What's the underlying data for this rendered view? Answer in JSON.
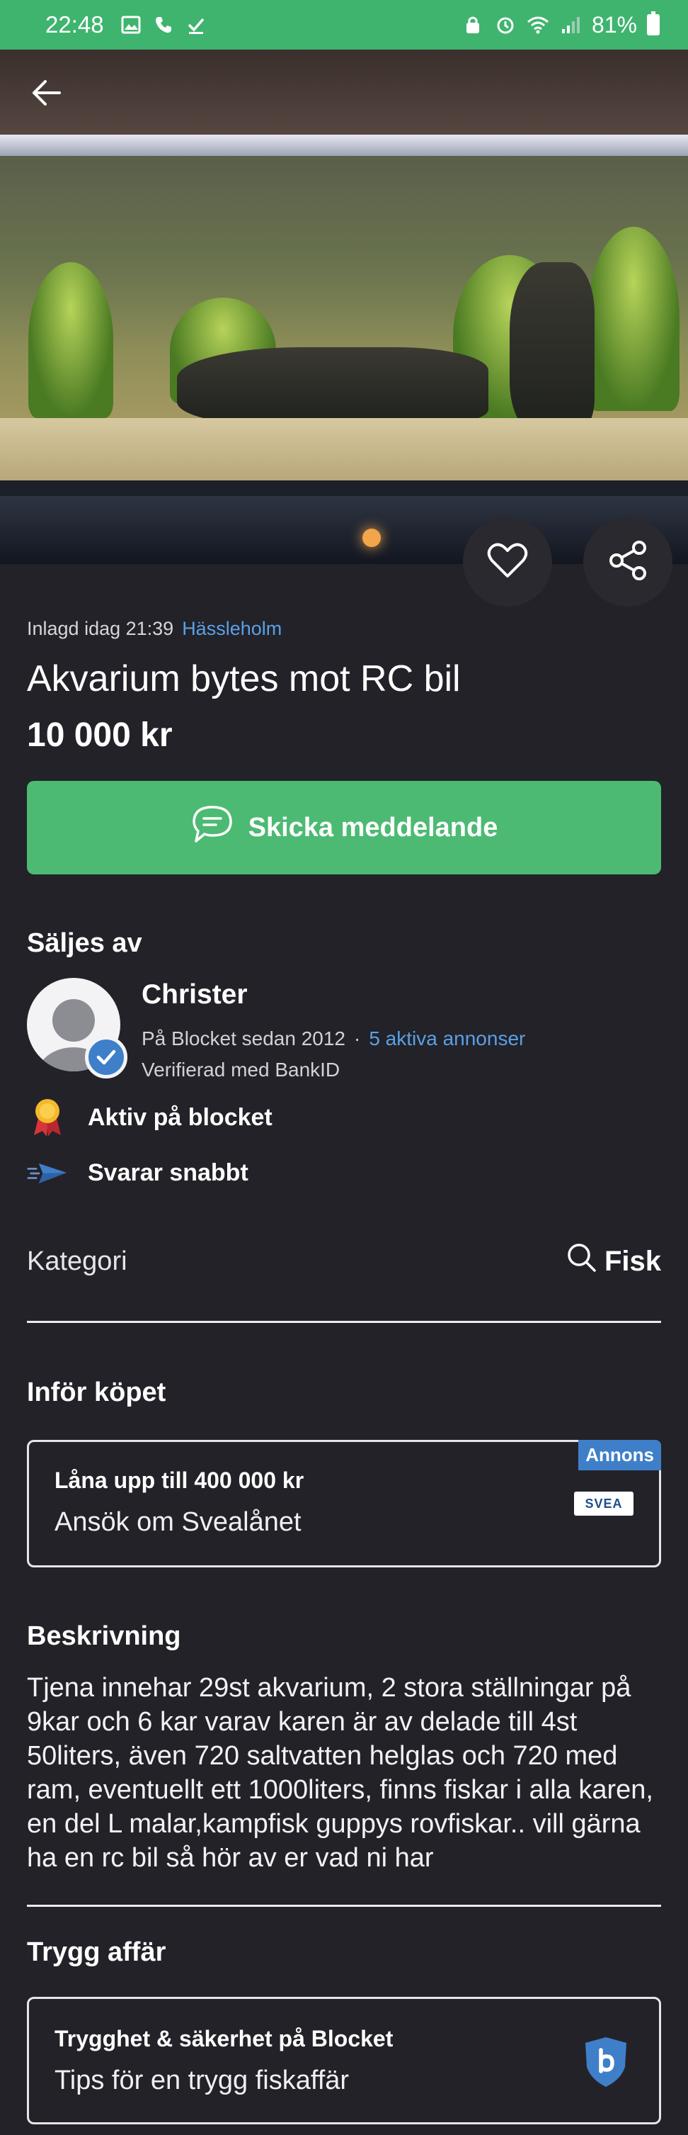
{
  "status_bar": {
    "time": "22:48",
    "battery": "81%",
    "icons": [
      "image-icon",
      "phone-icon",
      "check-icon",
      "lock-icon",
      "alarm-icon",
      "wifi-icon",
      "signal-icon",
      "battery-icon"
    ]
  },
  "listing": {
    "posted": "Inlagd idag 21:39",
    "location": "Hässleholm",
    "title": "Akvarium bytes mot RC bil",
    "price": "10 000 kr"
  },
  "actions": {
    "message_button": "Skicka meddelande"
  },
  "seller": {
    "heading": "Säljes av",
    "name": "Christer",
    "since": "På Blocket sedan 2012",
    "separator": "·",
    "active_ads": "5 aktiva annonser",
    "verified": "Verifierad med BankID",
    "badges": [
      {
        "label": "Aktiv på blocket",
        "icon": "medal-icon"
      },
      {
        "label": "Svarar snabbt",
        "icon": "paper-plane-icon"
      }
    ]
  },
  "category": {
    "label": "Kategori",
    "value": "Fisk"
  },
  "before_purchase": {
    "heading": "Inför köpet",
    "ad_tag": "Annons",
    "line1": "Låna upp till 400 000 kr",
    "line2": "Ansök om Svealånet",
    "logo_text": "SVEA"
  },
  "description": {
    "heading": "Beskrivning",
    "text": "Tjena innehar 29st akvarium, 2 stora ställningar på 9kar och 6 kar varav karen är av delade till 4st 50liters, även 720 saltvatten helglas och 720 med ram, eventuellt ett 1000liters, finns fiskar i alla karen, en del L malar,kampfisk guppys rovfiskar.. vill gärna ha en rc bil så hör av er vad ni har"
  },
  "safe_deal": {
    "heading": "Trygg affär",
    "line1": "Trygghet & säkerhet på Blocket",
    "line2": "Tips för en trygg fiskaffär"
  },
  "colors": {
    "background": "#232228",
    "status_bar": "#3fb46f",
    "cta": "#4cba73",
    "link": "#5aa0e6",
    "ad_tag": "#3f7fc9"
  }
}
